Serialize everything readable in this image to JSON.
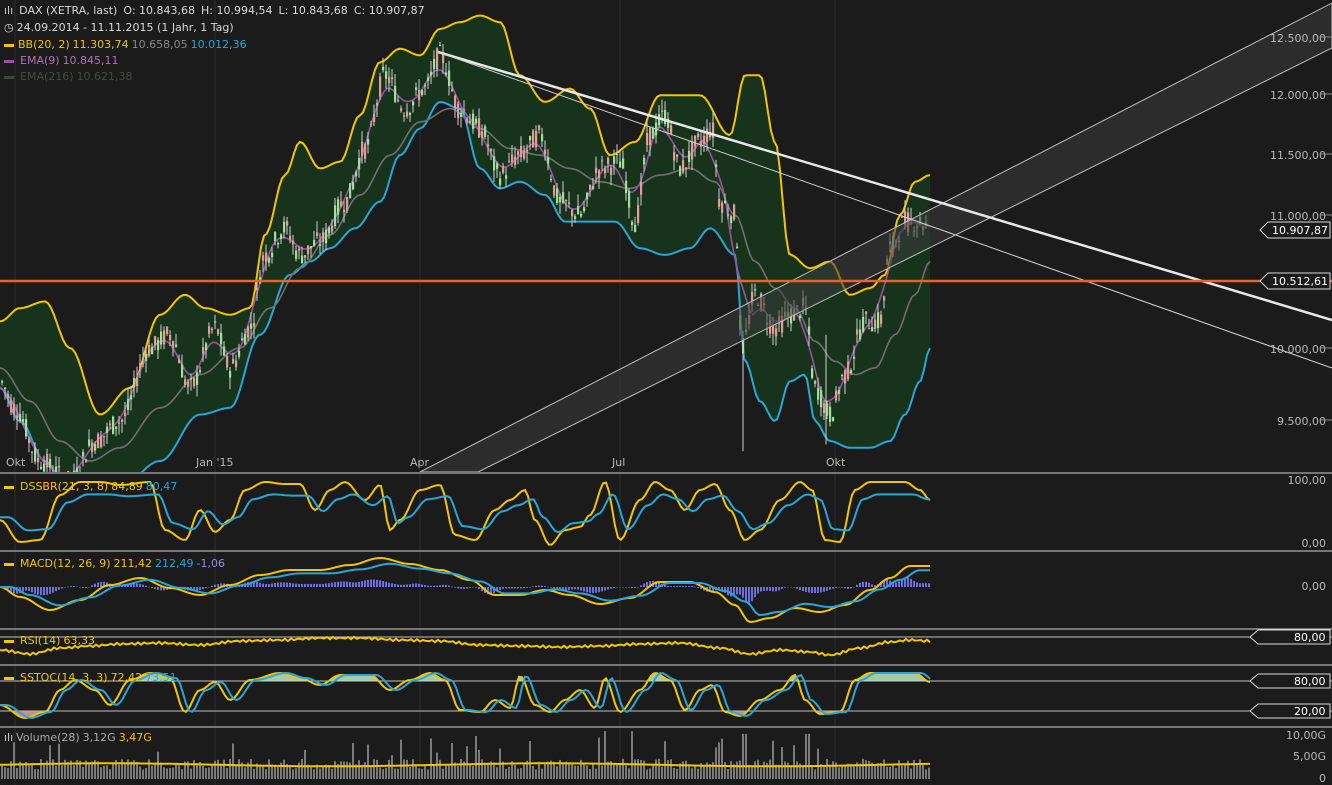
{
  "header": {
    "title_line": "DAX (XETRA, last)",
    "open": "O: 10.843,68",
    "high": "H: 10.994,54",
    "low": "L: 10.843,68",
    "close": "C: 10.907,87",
    "range": "24.09.2014 - 11.11.2015 (1 Jahr, 1 Tag)"
  },
  "legend": {
    "bb_label": "BB(20, 2)",
    "bb_v1": "11.303,74",
    "bb_v2": "10.658,05",
    "bb_v3": "10.012,36",
    "ema9_label": "EMA(9)",
    "ema9_v": "10.845,11",
    "ema216_label": "EMA(216)",
    "ema216_v": "10.621,38"
  },
  "panels": {
    "dss": {
      "label": "DSSBR(21, 3, 8)",
      "v1": "84,89",
      "v2": "80,47"
    },
    "macd": {
      "label": "MACD(12, 26, 9)",
      "v1": "211,42",
      "v2": "212,49",
      "v3": "-1,06"
    },
    "rsi": {
      "label": "RSI(14)",
      "v1": "63,33"
    },
    "sstoc": {
      "label": "SSTOC(14, 3, 3)",
      "v1": "72,42",
      "v2": "73,51"
    },
    "volume": {
      "label": "Volume(28)",
      "v1": "3,12G",
      "v2": "3,47G"
    }
  },
  "colors": {
    "background": "#1b1b1b",
    "bb_band": "#f2c500",
    "bb_lower": "#2aa6d6",
    "bb_fill": "#17331c",
    "ema9": "#9c4fa0",
    "ema216": "#707070",
    "support_line": "#e2652a",
    "trend_line": "#e6e6e6",
    "candle_up": "#9ee29a",
    "candle_down": "#e89a9a",
    "macd_hist": "#6f6fe0"
  },
  "chart_data": {
    "type": "line",
    "title": "DAX (XETRA, last)",
    "xlabel": "",
    "ylabel": "",
    "x_tick_labels": [
      "Okt",
      "Jan '15",
      "Apr",
      "Jul",
      "Okt"
    ],
    "y_tick_labels": [
      "12.500,00",
      "12.000,00",
      "11.500,00",
      "11.000,00",
      "10.000,00",
      "9.500,00"
    ],
    "ylim": [
      9200,
      12600
    ],
    "price_labels": {
      "last": "10.907,87",
      "support": "10.512,61"
    },
    "support_level": 10512.61,
    "series": [
      {
        "name": "DAX",
        "x": [
          "2014-10",
          "2014-11",
          "2014-12",
          "2015-01",
          "2015-02",
          "2015-03",
          "2015-04",
          "2015-05",
          "2015-06",
          "2015-07",
          "2015-08",
          "2015-09",
          "2015-10",
          "2015-11"
        ],
        "values": [
          9150,
          9300,
          9800,
          9750,
          10900,
          11900,
          12100,
          11500,
          11000,
          11550,
          10300,
          9600,
          10300,
          10910
        ]
      },
      {
        "name": "BB(20, 2)",
        "values": [
          10050,
          9900,
          10200,
          10500,
          11400,
          12200,
          12450,
          12000,
          11800,
          11900,
          11100,
          10400,
          10700,
          11300
        ]
      }
    ],
    "panels": [
      {
        "name": "DSSBR(21, 3, 8)",
        "y_tick_labels": [
          "100,00",
          "0,00"
        ]
      },
      {
        "name": "MACD(12, 26, 9)",
        "y_tick_labels": [
          "0,00"
        ]
      },
      {
        "name": "RSI(14)",
        "y_tick_labels": [
          "80,00"
        ]
      },
      {
        "name": "SSTOC(14, 3, 3)",
        "y_tick_labels": [
          "80,00",
          "20,00"
        ]
      },
      {
        "name": "Volume(28)",
        "y_tick_labels": [
          "10,00G",
          "5,00G",
          "0"
        ]
      }
    ]
  }
}
